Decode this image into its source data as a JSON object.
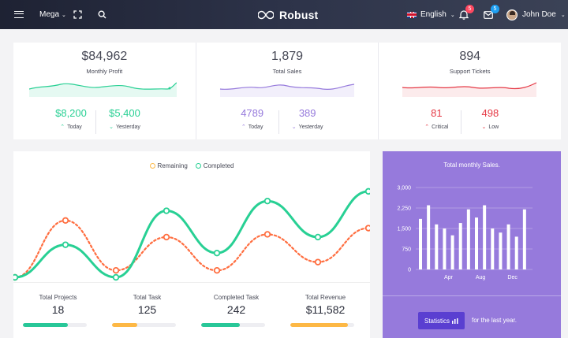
{
  "navbar": {
    "mega_label": "Mega",
    "brand": "Robust",
    "language": "English",
    "notifications_count": "5",
    "messages_count": "5",
    "user_name": "John Doe"
  },
  "stats": [
    {
      "value": "$84,962",
      "label": "Monthly Profit",
      "color": "#28d094",
      "sub": [
        {
          "value": "$8,200",
          "label": "Today",
          "dir": "up"
        },
        {
          "value": "$5,400",
          "label": "Yesterday",
          "dir": "down"
        }
      ]
    },
    {
      "value": "1,879",
      "label": "Total Sales",
      "color": "#967adc",
      "sub": [
        {
          "value": "4789",
          "label": "Today",
          "dir": "up"
        },
        {
          "value": "389",
          "label": "Yesterday",
          "dir": "down"
        }
      ]
    },
    {
      "value": "894",
      "label": "Support Tickets",
      "color": "#e53945",
      "sub": [
        {
          "value": "81",
          "label": "Critical",
          "dir": "up"
        },
        {
          "value": "498",
          "label": "Low",
          "dir": "down"
        }
      ]
    }
  ],
  "legend": {
    "remaining": "Remaining",
    "completed": "Completed"
  },
  "metrics": [
    {
      "label": "Total Projects",
      "value": "18",
      "progress": 0.7,
      "color": "#28c798"
    },
    {
      "label": "Total Task",
      "value": "125",
      "progress": 0.4,
      "color": "#fdb845"
    },
    {
      "label": "Completed Task",
      "value": "242",
      "progress": 0.6,
      "color": "#28c798"
    },
    {
      "label": "Total Revenue",
      "value": "$11,582",
      "progress": 0.9,
      "color": "#fdb845"
    }
  ],
  "sales": {
    "title": "Total monthly Sales.",
    "button_label": "Statistics",
    "footer_text": "for the last year."
  },
  "chart_data": [
    {
      "type": "line",
      "series": [
        {
          "name": "Completed",
          "color": "#28d094",
          "values": [
            0.0,
            0.47,
            0.0,
            0.96,
            0.35,
            1.1,
            0.58,
            1.24
          ]
        },
        {
          "name": "Remaining",
          "color": "#ff6e40",
          "values": [
            0.0,
            0.82,
            0.1,
            0.58,
            0.1,
            0.62,
            0.22,
            0.71
          ]
        }
      ]
    },
    {
      "type": "bar",
      "title": "Total monthly Sales.",
      "ylim": [
        0,
        3000
      ],
      "yticks": [
        "0",
        "750",
        "1,500",
        "2,250",
        "3,000"
      ],
      "categories": [
        "Apr",
        "Aug",
        "Dec"
      ],
      "values": [
        1850,
        2350,
        1650,
        1500,
        1250,
        1700,
        2200,
        1900,
        2350,
        1500,
        1350,
        1650,
        1200,
        2200
      ]
    }
  ]
}
